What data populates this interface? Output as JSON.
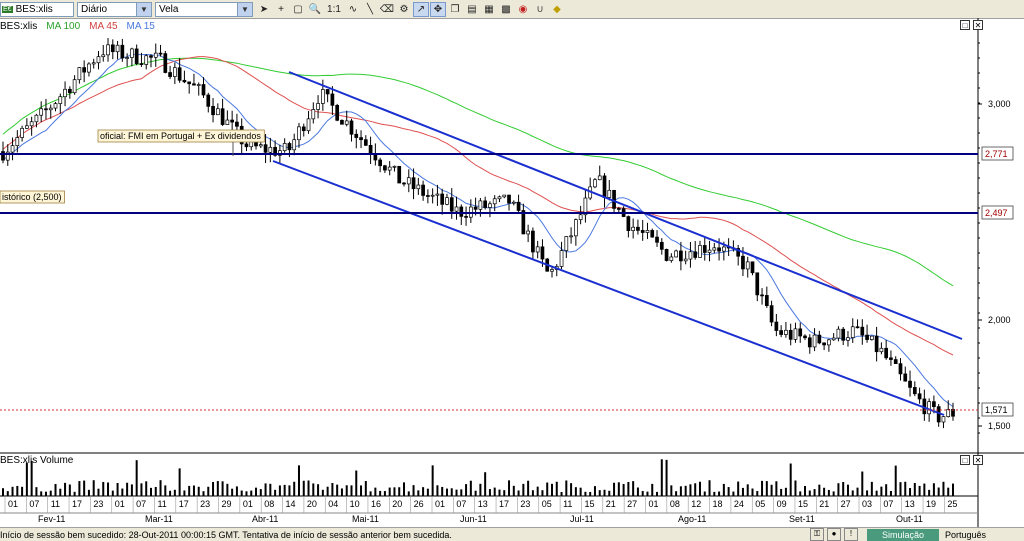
{
  "toolbar": {
    "symbol": "BES:xlis",
    "period": "Diário",
    "chart_type": "Vela",
    "icons": [
      "pointer-icon",
      "crosshair-icon",
      "info-icon",
      "zoom-icon",
      "zoom-1-1-icon",
      "wave-icon",
      "line-icon",
      "eraser-icon",
      "layout-icon",
      "trend-icon",
      "magnet-icon",
      "clone-icon",
      "print-icon",
      "image-icon",
      "grid-icon",
      "sound-icon",
      "horseshoe-icon",
      "shape-icon"
    ],
    "zoom_label": "1:1"
  },
  "legend": {
    "symbol": "BES:xlis",
    "ma100": "MA 100",
    "ma45": "MA 45",
    "ma15": "MA 15"
  },
  "colors": {
    "ma100": "#33cc33",
    "ma45": "#e05050",
    "ma15": "#4a78e0",
    "channel": "#1a2fd0",
    "hline": "#000080",
    "last": "#d03030"
  },
  "annotations": {
    "event": "oficial: FMI em Portugal + Ex dividendos",
    "historic": "istórico (2,500)"
  },
  "chart_data": {
    "type": "candlestick",
    "y_ticks": [
      "3,000",
      "2,000",
      "1,500"
    ],
    "price_tags": [
      "2,771",
      "2,497",
      "1,571"
    ],
    "h_lines": [
      2.771,
      2.497
    ],
    "last_price": 1.571,
    "months": [
      "Fev-11",
      "Mar-11",
      "Abr-11",
      "Mai-11",
      "Jun-11",
      "Jul-11",
      "Ago-11",
      "Set-11",
      "Out-11"
    ],
    "days": [
      "01",
      "07",
      "11",
      "17",
      "23",
      "01",
      "07",
      "11",
      "17",
      "23",
      "29",
      "01",
      "08",
      "14",
      "20",
      "04",
      "10",
      "16",
      "20",
      "26",
      "01",
      "07",
      "13",
      "17",
      "23",
      "05",
      "11",
      "15",
      "21",
      "27",
      "01",
      "08",
      "12",
      "18",
      "24",
      "05",
      "09",
      "15",
      "21",
      "27",
      "03",
      "07",
      "13",
      "19",
      "25"
    ]
  },
  "volume": {
    "legend": "BES:xlis Volume"
  },
  "status": {
    "message": "Início de sessão bem sucedido: 28-Out-2011 00:00:15 GMT. Tentativa de início de sessão anterior bem sucedida.",
    "sim_label": "Simulação",
    "language": "Português"
  }
}
